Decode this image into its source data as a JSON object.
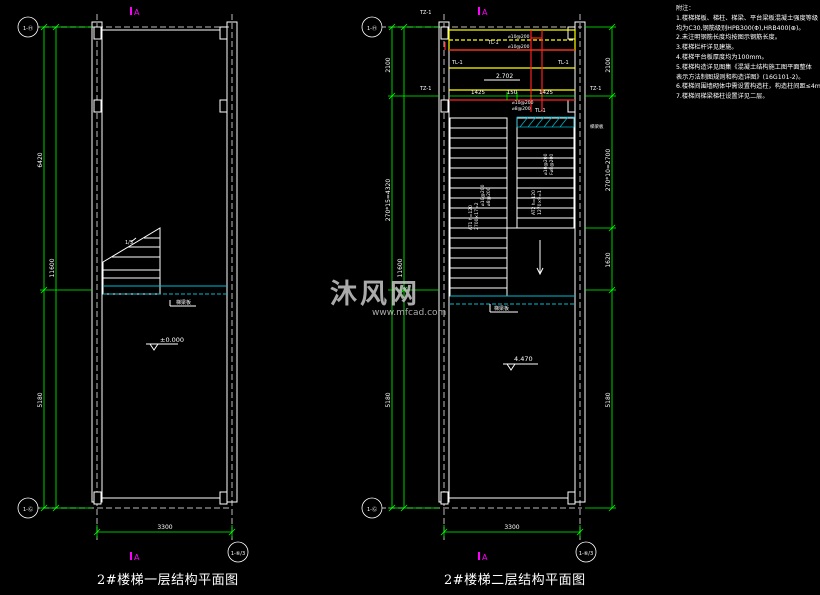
{
  "drawings": [
    {
      "title": "2#楼梯一层结构平面图",
      "axis_top": "1-Ⓗ",
      "axis_bottom": "1-Ⓖ",
      "axis_bottom_right": "1-⑥/3",
      "axis_marker": "A",
      "dim_width": "3300",
      "dim_upper": "6420",
      "dim_total": "11600",
      "dim_lower": "5180",
      "level": "±0.000",
      "stair_note": "1/5",
      "beam_label": "梯梁板"
    },
    {
      "title": "2#楼梯二层结构平面图",
      "axis_top": "1-Ⓗ",
      "axis_bottom": "1-Ⓖ",
      "axis_bottom_right": "1-⑥/3",
      "axis_marker": "A",
      "dim_width": "3300",
      "dim_top_left": "2100",
      "dim_top_right": "2100",
      "dim_mid_left": "270*15=4320",
      "dim_mid_right": "270*10=2700",
      "dim_right_2": "1620",
      "dim_total": "11600",
      "dim_lower": "5180",
      "dim_sub_a": "1425",
      "dim_sub_b": "150",
      "dim_sub_c": "1425",
      "level_mid": "2.702",
      "level": "4.470",
      "labels": {
        "tz_tl": "TZ-1",
        "tz_ml": "TZ-1",
        "tz_mr": "TZ-1",
        "tl_top": "TL-1",
        "tl_left": "TL-1",
        "tl_right": "TL-1",
        "tl_mid": "TL-1",
        "rebar_a": "⌀10@200",
        "rebar_b": "⌀10@200",
        "rebar_c": "⌀10@200",
        "rebar_d": "⌀8@200",
        "slab_note": "梯梁板",
        "stair_left": "AT1 h=120",
        "stair_left_2": "2700×17=2",
        "stair_left_3": "⌀10@200",
        "stair_left_4": "⌀8@200",
        "stair_right": "AT2 h=120",
        "stair_right_2": "1270×9=1",
        "stair_right_3": "⌀10@200",
        "stair_right_4": "F⌀8@200",
        "beam_label": "梯梁板"
      }
    }
  ],
  "notes": {
    "heading": "附注：",
    "lines": [
      "1.楼梯梯板、梯柱、梯梁、平台梁板混凝土强度等级",
      "  均为C30,钢筋级别HPB300(Φ),HRB400(⊕)。",
      "2.未注明钢筋长度均按图示钢筋长度。",
      "3.楼梯栏杆详见建施。",
      "4.楼梯平台板厚度均为100mm。",
      "5.楼梯构造详见图集《混凝土结构施工图平面整体",
      "  表示方法制图规则和构造详图》(16G101-2)。",
      "6.楼梯间围墙砌体中需设置构造柱，构造柱间距≤4m。",
      "7.楼梯间梯梁梯柱设置详见二层。"
    ]
  },
  "watermark": {
    "brand": "沐风网",
    "url": "www.mfcad.com"
  },
  "colors": {
    "background": "#000000",
    "line": "#ffffff",
    "dimension": "#00ff00",
    "axis_marker": "#ff00ff",
    "beam": "#ff2020",
    "slab": "#ffff00",
    "hatch": "#00bcd4"
  }
}
